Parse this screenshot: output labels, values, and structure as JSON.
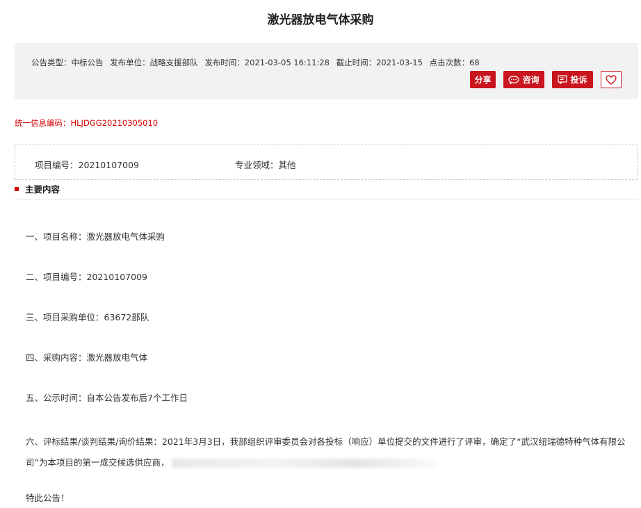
{
  "title": "激光器放电气体采购",
  "meta": {
    "type": "公告类型：中标公告",
    "unit": "发布单位：战略支援部队",
    "publish_time": "发布时间：2021-03-05 16:11:28",
    "deadline": "截止时间：2021-03-15",
    "clicks": "点击次数：68"
  },
  "buttons": {
    "share": "分享",
    "consult": "咨询",
    "complain": "投诉"
  },
  "icons": {
    "consult": "chat-icon",
    "complain": "complaint-icon",
    "favorite": "heart-icon"
  },
  "code_line": "统一信息编码：HLJDGG20210305010",
  "project": {
    "number": "项目编号：20210107009",
    "field": "专业领域：其他"
  },
  "section_title": "主要内容",
  "content": {
    "p1": "一、项目名称：激光器放电气体采购",
    "p2": "二、项目编号：20210107009",
    "p3": "三、项目采购单位：63672部队",
    "p4": "四、采购内容：激光器放电气体",
    "p5": "五、公示时间：自本公告发布后7个工作日",
    "p6": "六、评标结果/谈判结果/询价结果：2021年3月3日，我部组织评审委员会对各投标（响应）单位提交的文件进行了评审，确定了“武汉纽瑞德特种气体有限公司”为本项目的第一成交候选供应商，",
    "p7": "特此公告！"
  },
  "colors": {
    "accent": "#c9151e",
    "code_text": "#d40000",
    "meta_bg": "#f2f2f2"
  }
}
